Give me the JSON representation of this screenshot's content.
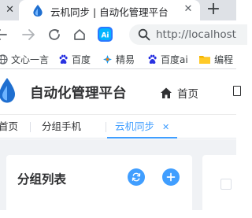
{
  "browser": {
    "prev_tab_close_glyph": "✕",
    "active_tab": {
      "title": "云机同步 | 自动化管理平台",
      "close_glyph": "✕"
    },
    "new_tab_glyph": "+",
    "address": {
      "value": "http://localhost"
    },
    "bookmarks": [
      {
        "label": "文心一言",
        "icon": "globe-icon"
      },
      {
        "label": "百度",
        "icon": "baidu-paw-icon"
      },
      {
        "label": "精易",
        "icon": "jingyi-icon"
      },
      {
        "label": "百度ai",
        "icon": "baidu-paw-icon"
      },
      {
        "label": "编程",
        "icon": "folder-icon"
      }
    ]
  },
  "app": {
    "title": "自动化管理平台",
    "nav": {
      "home_label": "首页"
    },
    "tags": [
      {
        "label": "首页",
        "active": false
      },
      {
        "label": "分组手机",
        "active": false
      },
      {
        "label": "云机同步",
        "active": true,
        "close_glyph": "✕"
      }
    ],
    "group_panel": {
      "title": "分组列表"
    }
  },
  "colors": {
    "accent": "#409eff",
    "tabstrip": "#dee1e6",
    "content_bg": "#f0f2f5",
    "logo_blue": "#1f6fd0"
  }
}
